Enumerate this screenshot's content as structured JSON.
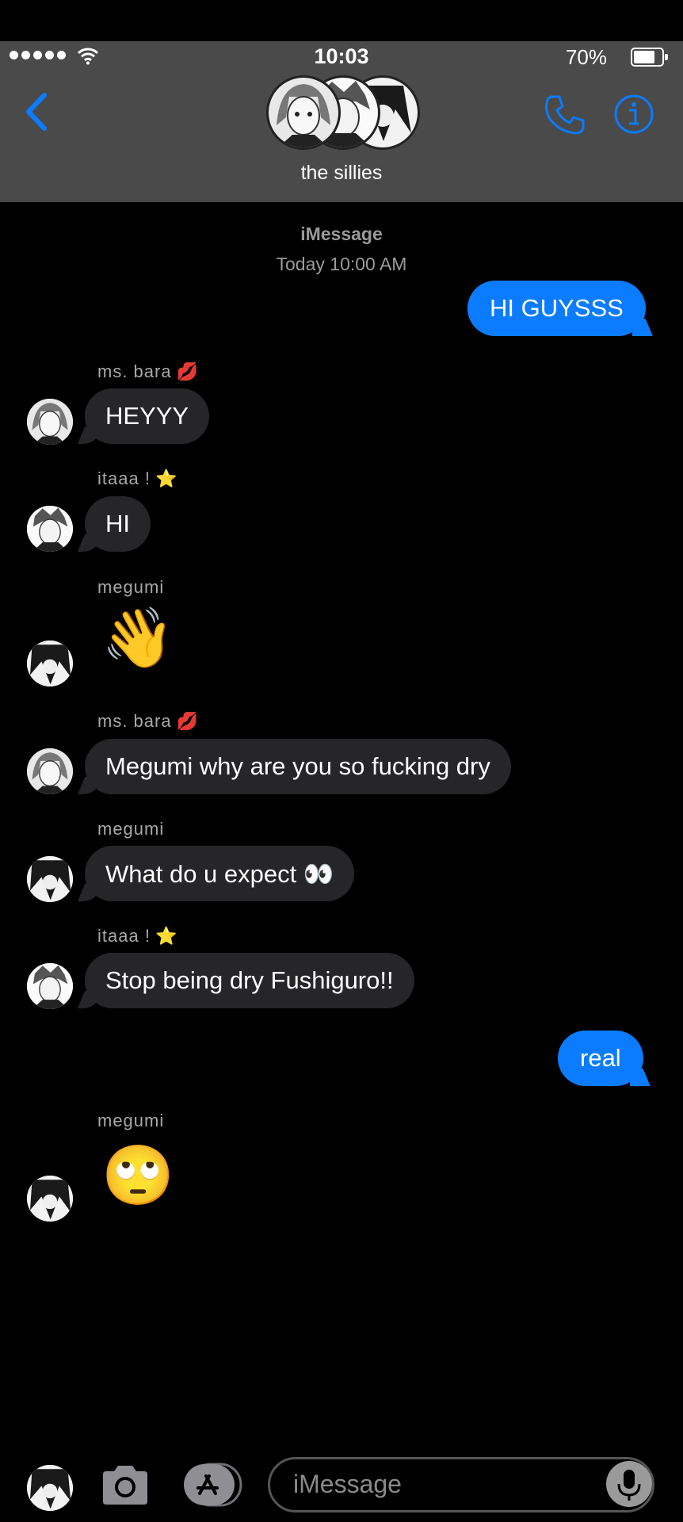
{
  "status_bar": {
    "time": "10:03",
    "battery_percent": "70%",
    "battery_level": 0.7,
    "signal_bars": 5
  },
  "header": {
    "group_name": "the sillies",
    "back_icon": "chevron-left-icon",
    "call_icon": "phone-icon",
    "info_icon": "info-icon",
    "accent_color": "#0b7cff",
    "bar_color": "#4a4a4a"
  },
  "thread": {
    "service": "iMessage",
    "timestamp": "Today 10:00 AM"
  },
  "messages": [
    {
      "direction": "out",
      "text": "HI GUYSSS"
    },
    {
      "direction": "in",
      "sender": "ms. bara",
      "sender_emoji": "💋",
      "text": "HEYYY"
    },
    {
      "direction": "in",
      "sender": "itaaa !",
      "sender_emoji": "⭐",
      "text": "HI"
    },
    {
      "direction": "in",
      "sender": "megumi",
      "sender_emoji": "",
      "emoji_only": "👋"
    },
    {
      "direction": "in",
      "sender": "ms. bara",
      "sender_emoji": "💋",
      "text": "Megumi why are you so fucking dry"
    },
    {
      "direction": "in",
      "sender": "megumi",
      "sender_emoji": "",
      "text": "What do u expect 👀"
    },
    {
      "direction": "in",
      "sender": "itaaa !",
      "sender_emoji": "⭐",
      "text": "Stop being dry Fushiguro!!"
    },
    {
      "direction": "out",
      "text": "real"
    },
    {
      "direction": "in",
      "sender": "megumi",
      "sender_emoji": "",
      "emoji_only": "🙄"
    }
  ],
  "composer": {
    "placeholder": "iMessage",
    "camera_icon": "camera-icon",
    "appstore_icon": "app-store-icon",
    "mic_icon": "microphone-icon"
  }
}
